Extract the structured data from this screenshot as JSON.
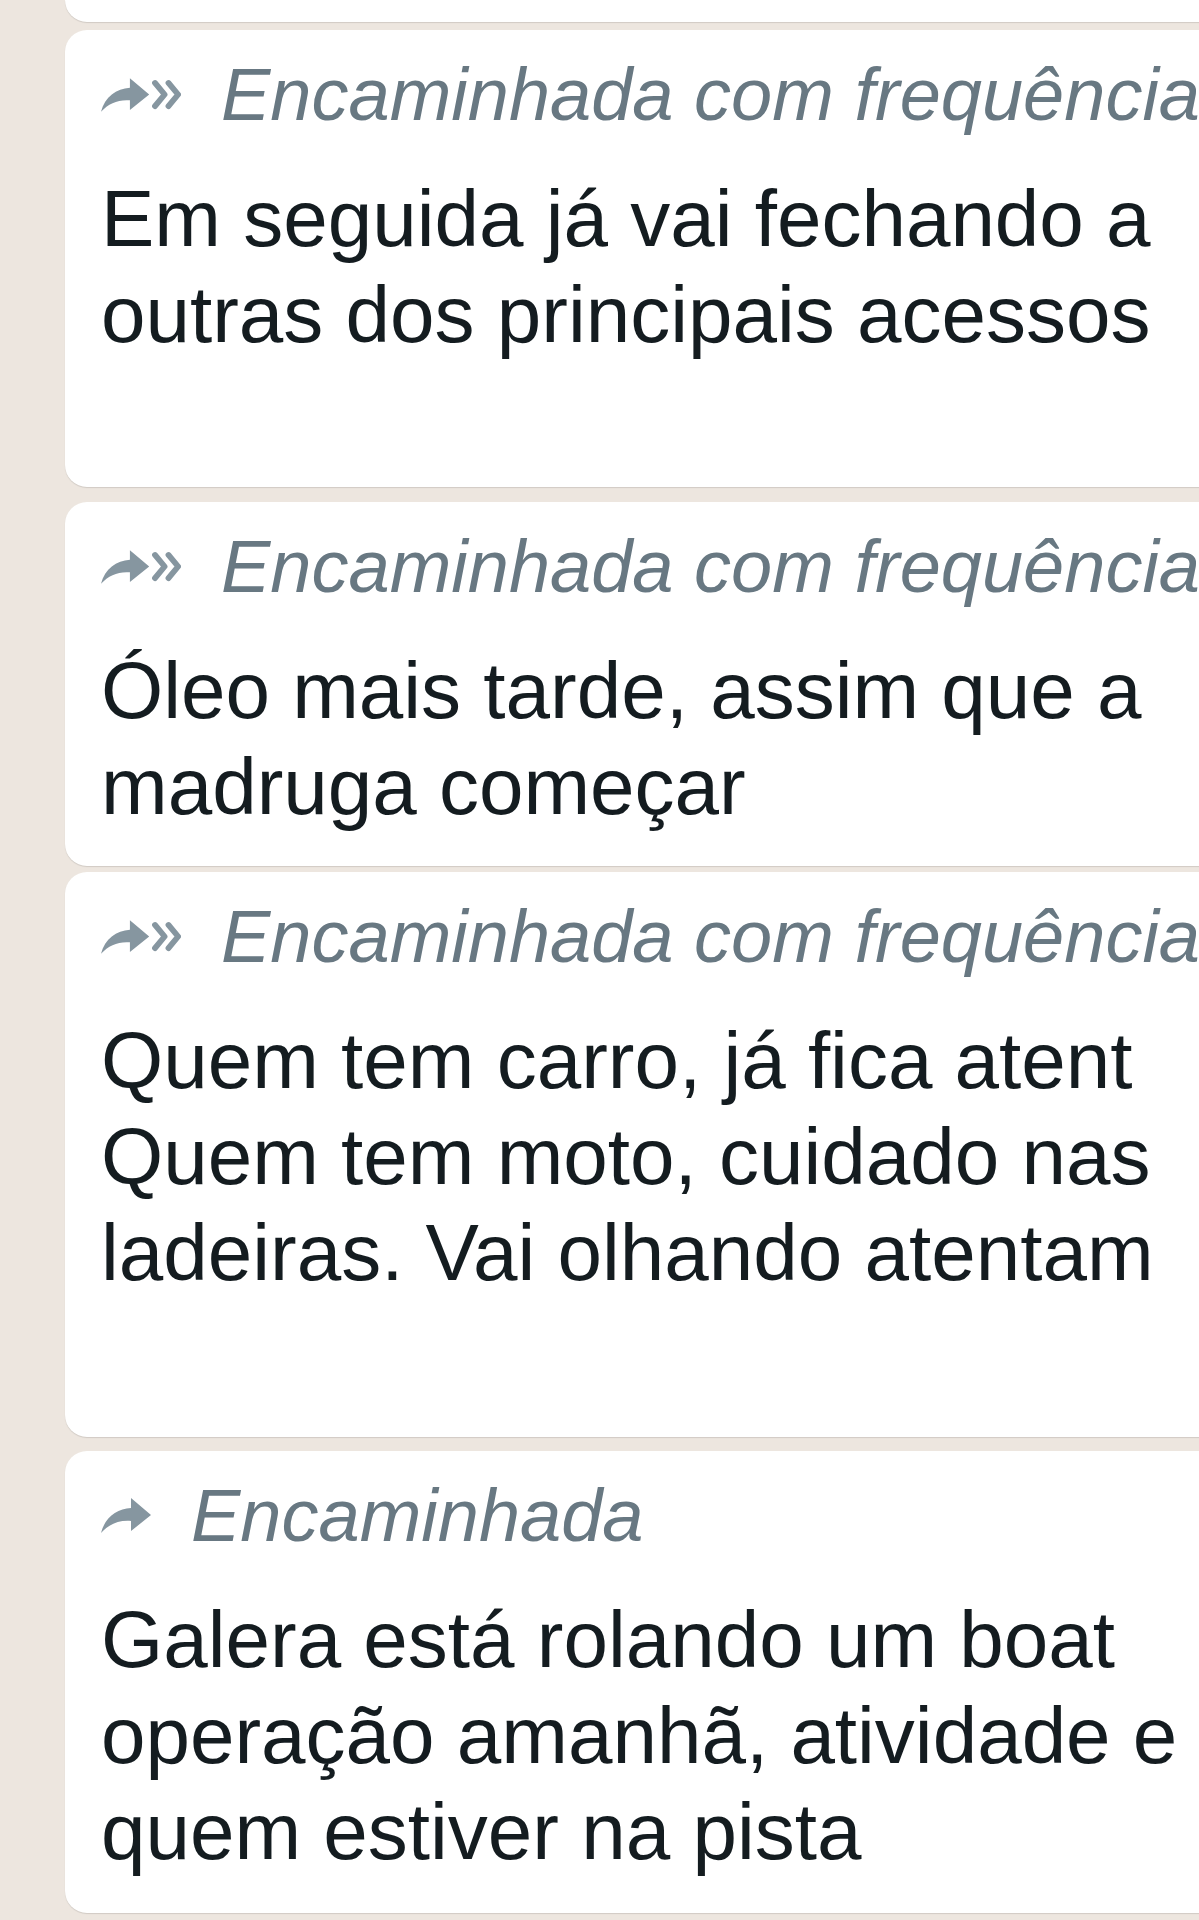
{
  "messages": [
    {
      "forwarded": {
        "kind": "frequent",
        "label": "Encaminhada com frequência"
      },
      "lines": [
        "Em seguida já vai fechando a",
        "outras dos principais acessos"
      ]
    },
    {
      "forwarded": {
        "kind": "frequent",
        "label": "Encaminhada com frequência"
      },
      "lines": [
        "Óleo mais tarde, assim que a",
        "madruga começar"
      ]
    },
    {
      "forwarded": {
        "kind": "frequent",
        "label": "Encaminhada com frequência"
      },
      "lines": [
        "Quem tem carro, já fica atent",
        "Quem tem moto, cuidado nas",
        "ladeiras. Vai olhando atentam"
      ]
    },
    {
      "forwarded": {
        "kind": "single",
        "label": "Encaminhada"
      },
      "lines": [
        "Galera está rolando um boat",
        "operação amanhã, atividade e",
        "quem estiver na pista"
      ]
    }
  ]
}
